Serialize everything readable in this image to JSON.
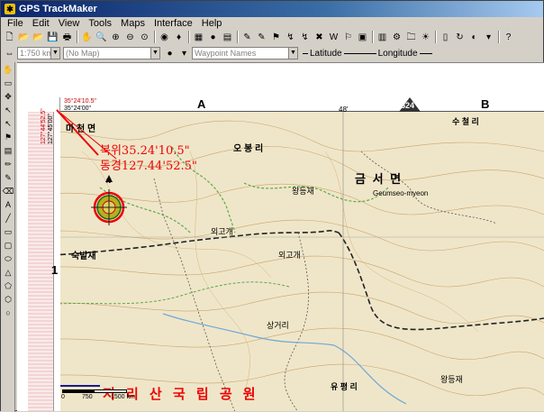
{
  "title": "GPS TrackMaker",
  "menu": [
    "File",
    "Edit",
    "View",
    "Tools",
    "Maps",
    "Interface",
    "Help"
  ],
  "toolbar2": {
    "scale": "1:750 km",
    "map": "(No Map)",
    "waypoint_placeholder": "Waypoint Names",
    "latitude_label": "Latitude",
    "longitude_label": "Longitude"
  },
  "map": {
    "col_a": "A",
    "col_b": "B",
    "row_1": "1",
    "grid_num": "524",
    "corner_lat": "35°24'10.5\"",
    "corner_lat2": "35°24'00\"",
    "corner_lon": "127°44'52.5\"",
    "corner_lon2": "127°45'00\"",
    "minute_mark": "48'",
    "annot_lat": "북위35.24'10.5\"",
    "annot_lon": "동경127.44'52.5\"",
    "compass_n": "N",
    "place_machon": "마 천 면",
    "place_obong": "오 봉 리",
    "place_geumseo": "금 서 면",
    "place_geumseo_roman": "Geumseo-myeon",
    "place_suchul": "수 철 리",
    "place_wangdeung": "왕등재",
    "place_wangdeung2": "왕등재",
    "place_sukbat": "숙밭재",
    "place_oegogae": "외고개",
    "place_oegogae2": "외고개",
    "place_sangeori": "상거리",
    "place_yupyeong": "유 평 리",
    "place_park": "지 리 산 국 립 공 원",
    "scale_0": "0",
    "scale_750": "750",
    "scale_1500": "1500 km"
  }
}
